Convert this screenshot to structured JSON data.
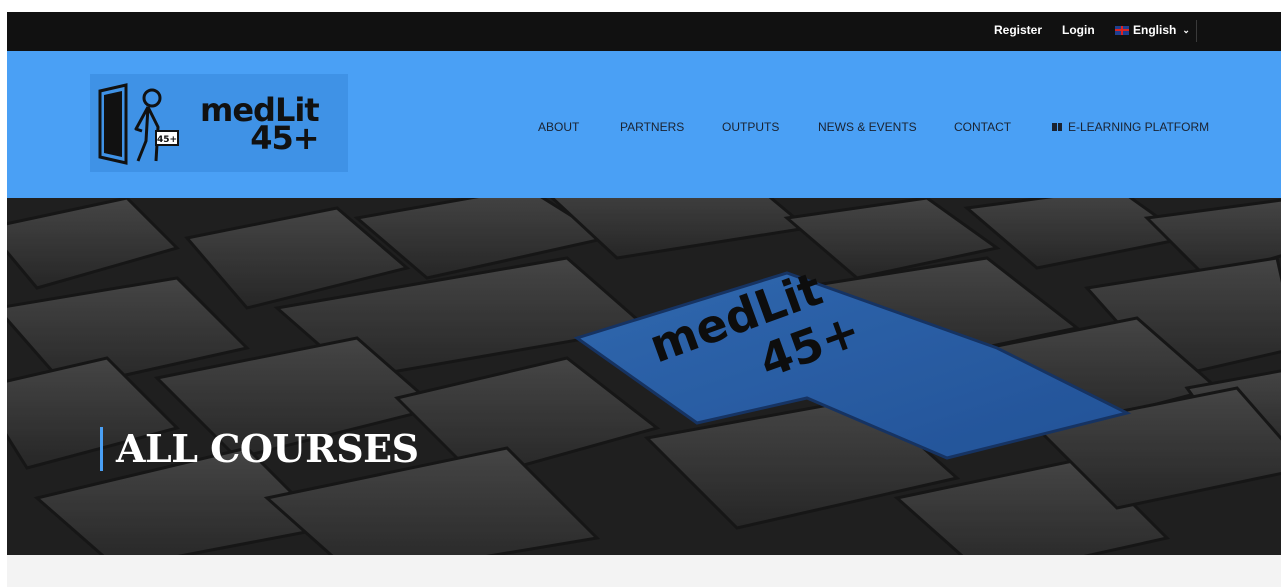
{
  "topbar": {
    "register_label": "Register",
    "login_label": "Login",
    "language_label": "English"
  },
  "logo": {
    "line1": "medLit",
    "line2": "45+",
    "badge": "45+"
  },
  "nav": {
    "items": [
      "About",
      "Partners",
      "Outputs",
      "News & Events",
      "Contact",
      "E-Learning Platform"
    ]
  },
  "hero": {
    "title": "ALL COURSES",
    "key_text_1": "medLit",
    "key_text_2": "45+"
  },
  "colors": {
    "accent": "#4aa0f5",
    "topbar": "#111111",
    "key_highlight": "#2f6ec4"
  }
}
